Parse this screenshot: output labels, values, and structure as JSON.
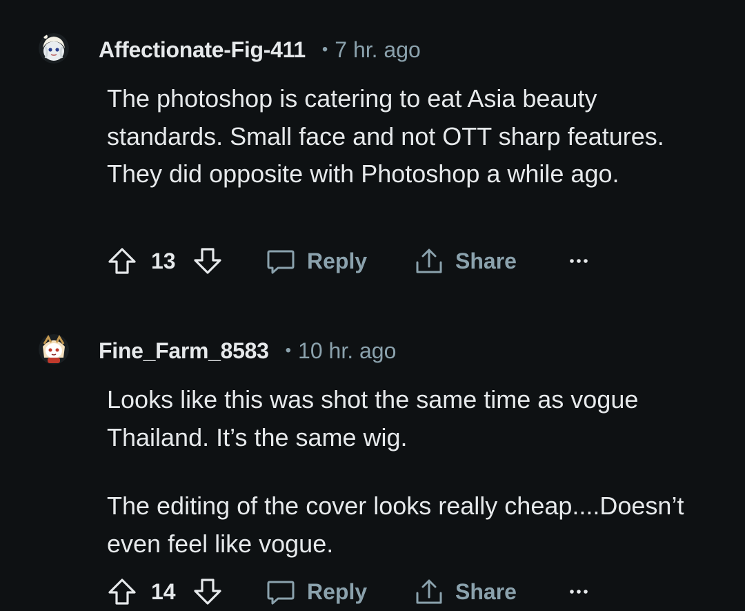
{
  "comments": [
    {
      "author": "Affectionate-Fig-411",
      "separator": "•",
      "time": "7 hr. ago",
      "paragraphs": [
        "The photoshop is catering to eat Asia beauty standards. Small face and not OTT sharp features. They did opposite with Photoshop a while ago."
      ],
      "score": "13",
      "reply_label": "Reply",
      "share_label": "Share",
      "avatar_icon": "snoo-avatar-white-hair",
      "upvote_icon": "upvote-arrow-icon",
      "downvote_icon": "downvote-arrow-icon",
      "reply_icon": "speech-bubble-icon",
      "share_icon": "share-upload-icon",
      "more_icon": "ellipsis-icon"
    },
    {
      "author": "Fine_Farm_8583",
      "separator": "•",
      "time": "10 hr. ago",
      "paragraphs": [
        "Looks like this was shot the same time as vogue Thailand. It’s the same wig.",
        "The editing of the cover looks really cheap....Doesn’t even feel like vogue."
      ],
      "score": "14",
      "reply_label": "Reply",
      "share_label": "Share",
      "avatar_icon": "snoo-avatar-headband",
      "upvote_icon": "upvote-arrow-icon",
      "downvote_icon": "downvote-arrow-icon",
      "reply_icon": "speech-bubble-icon",
      "share_icon": "share-upload-icon",
      "more_icon": "ellipsis-icon"
    }
  ],
  "colors": {
    "background": "#0e1113",
    "text": "#e6e9eb",
    "muted": "#8ba2ad"
  }
}
